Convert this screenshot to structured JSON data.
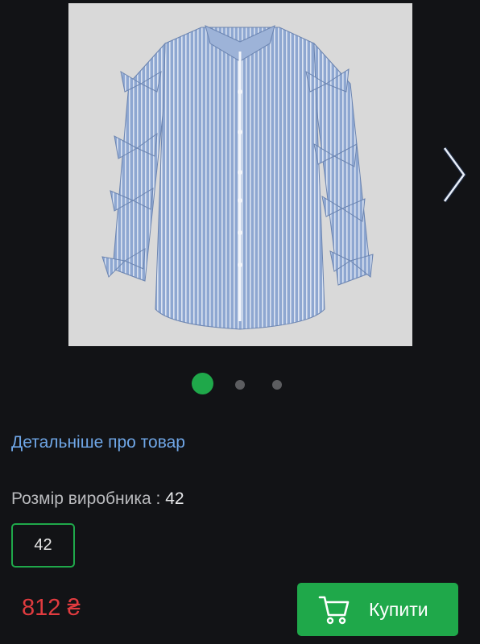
{
  "product": {
    "image_alt": "striped shirt with bows",
    "image_bg": "#d9d9d9",
    "shirt_color": "#8da6cf"
  },
  "carousel": {
    "slide_count": 3,
    "active_index": 0,
    "active_color": "#1fa84a"
  },
  "details_link": "Детальніше про товар",
  "size": {
    "label": "Розмір виробника : ",
    "value": "42",
    "options": [
      "42"
    ],
    "selected": "42"
  },
  "price": "812 ₴",
  "buy_button": {
    "label": "Купити",
    "icon": "cart-icon"
  },
  "colors": {
    "accent": "#1fa84a",
    "price": "#e03b3f",
    "link": "#6fa6e6",
    "background": "#121316"
  }
}
